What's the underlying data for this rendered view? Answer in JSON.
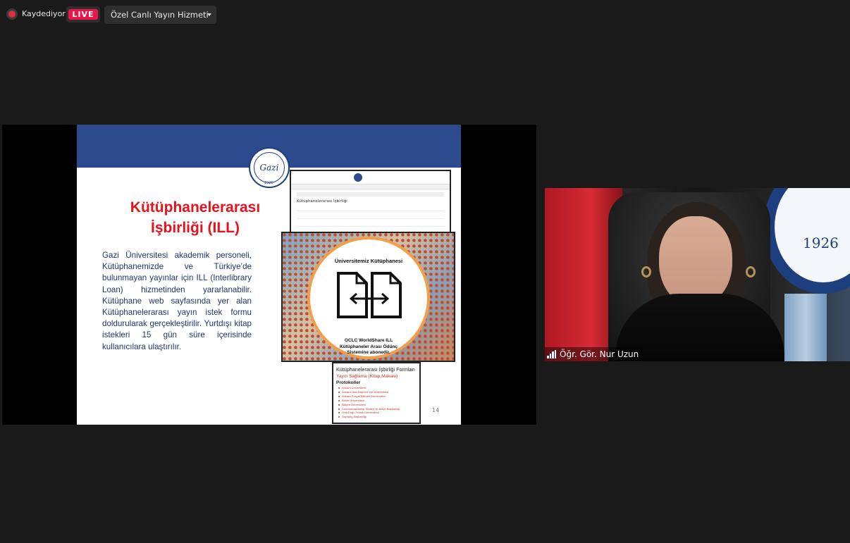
{
  "topbar": {
    "recording_label": "Kaydediyor",
    "live_badge": "LIVE",
    "service_label": "Özel Canlı Yayın Hizmeti"
  },
  "slide": {
    "title_line1": "Kütüphanelerarası",
    "title_line2": "İşbirliği (ILL)",
    "body": "Gazi Üniversitesi akademik personeli, Kütüphanemizde ve Türkiye’de bulunmayan yayınlar için ILL (Interlibrary Loan) hizmetinden yararlanabilir. Kütüphane web sayfasında yer alan Kütüphanelerarası yayın istek formu doldurularak gerçekleştirilir. Yurtdışı kitap istekleri 15 gün süre içerisinde kullanıcılara ulaştırılır.",
    "page_number": "14",
    "logo_year": "1926",
    "web_heading": "Kütüphanelerarası İşbirliği",
    "ill_graphic": {
      "top_text": "Üniversitemiz Kütüphanesi",
      "bottom_line1": "OCLC WorldShare ILL",
      "bottom_line2": "Kütüphaneler Arası Ödünç",
      "bottom_line3": "Sistemine abonedir."
    },
    "forms_box": {
      "title": "Kütüphanelerarası İşbirliği Formları",
      "link": "Yayın Sağlama (Kitap,Makale)",
      "subtitle": "Protokoller",
      "items": [
        "Ankara Üniversitesi",
        "Ankara Hacı Bayram Veli Üniversitesi",
        "Ankara Sosyal Bilimler Üniversitesi",
        "Atılım Üniversitesi",
        "Bilkent Üniversitesi",
        "Cumhurbaşkanlığı Strateji ve Bütçe Başkanlığı",
        "Orta Doğu Teknik Üniversitesi",
        "Sayıştay Başkanlığı"
      ]
    }
  },
  "participant": {
    "name": "Öğr. Gör. Nur Uzun",
    "seal_year": "1926"
  },
  "colors": {
    "live": "#e8164b",
    "slide_band": "#2c4a8c",
    "slide_title": "#e8121c",
    "slide_text": "#22356b"
  }
}
